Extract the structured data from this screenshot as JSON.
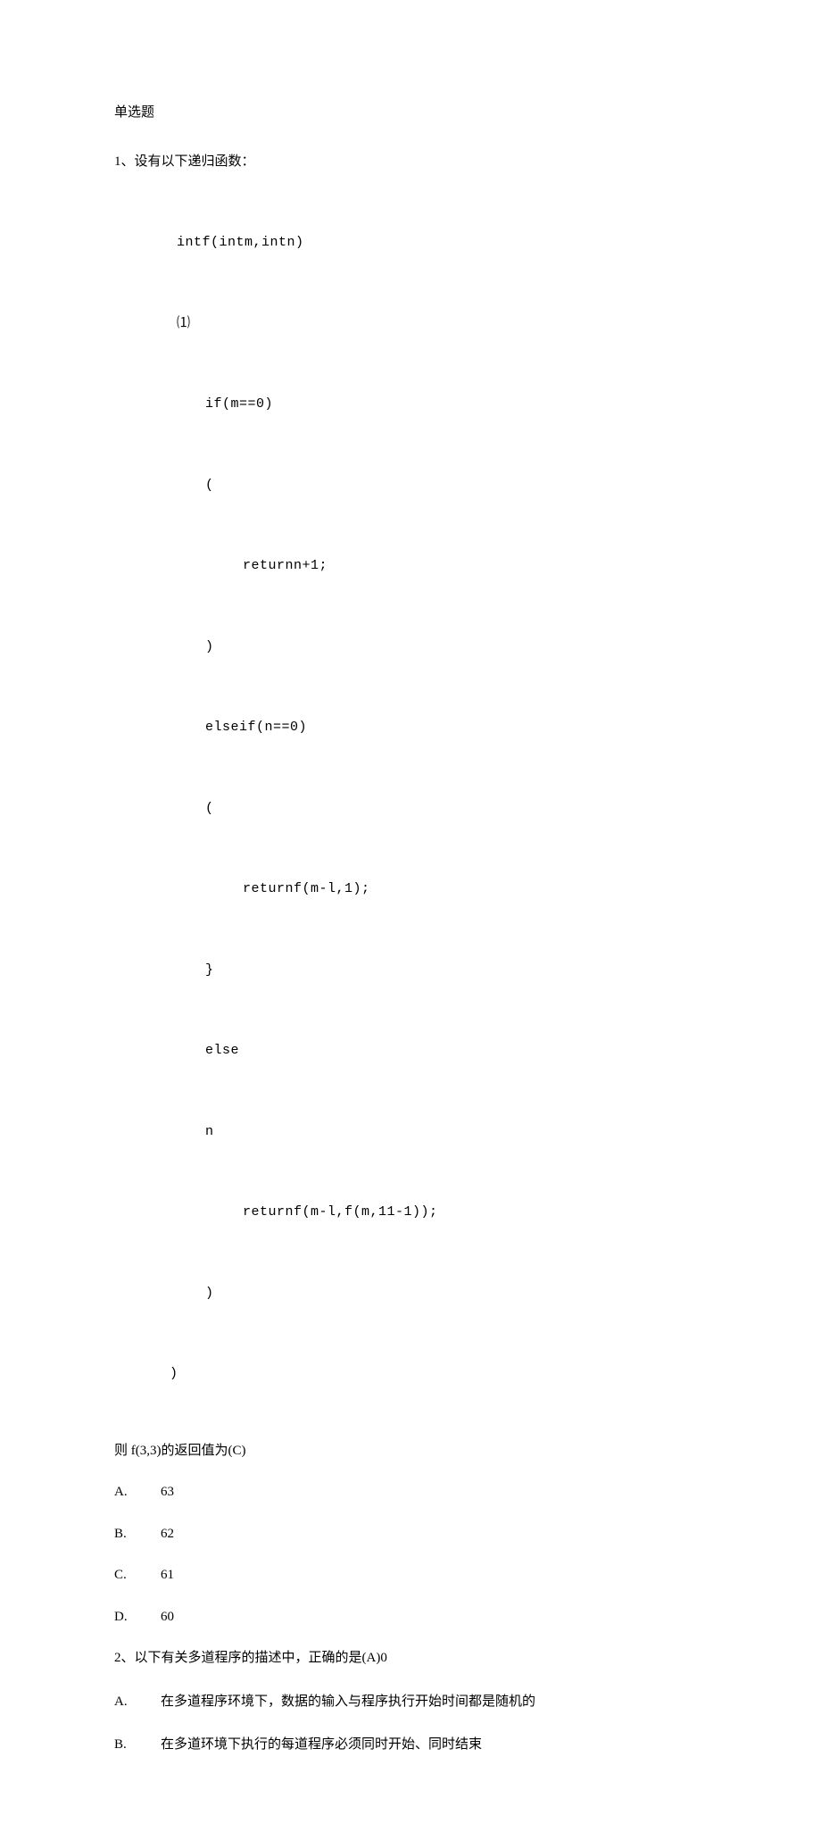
{
  "header": "单选题",
  "q1": {
    "lead": "1、设有以下递归函数：",
    "code": [
      "intf(intm,intn)",
      "⑴",
      "if(m==0)",
      "(",
      "returnn+1;",
      ")",
      "elseif(n==0)",
      "(",
      "returnf(m-l,1);",
      "}",
      "else",
      "n",
      "returnf(m-l,f(m,11-1));",
      ")",
      ")"
    ],
    "result": "则 f(3,3)的返回值为(C)",
    "options": [
      {
        "letter": "A.",
        "text": "63"
      },
      {
        "letter": "B.",
        "text": "62"
      },
      {
        "letter": "C.",
        "text": "61"
      },
      {
        "letter": "D.",
        "text": "60"
      }
    ]
  },
  "q2": {
    "lead": "2、以下有关多道程序的描述中，正确的是(A)0",
    "options": [
      {
        "letter": "A.",
        "text": "在多道程序环境下，数据的输入与程序执行开始时间都是随机的"
      },
      {
        "letter": "B.",
        "text": "在多道环境下执行的每道程序必须同时开始、同时结束"
      }
    ]
  }
}
